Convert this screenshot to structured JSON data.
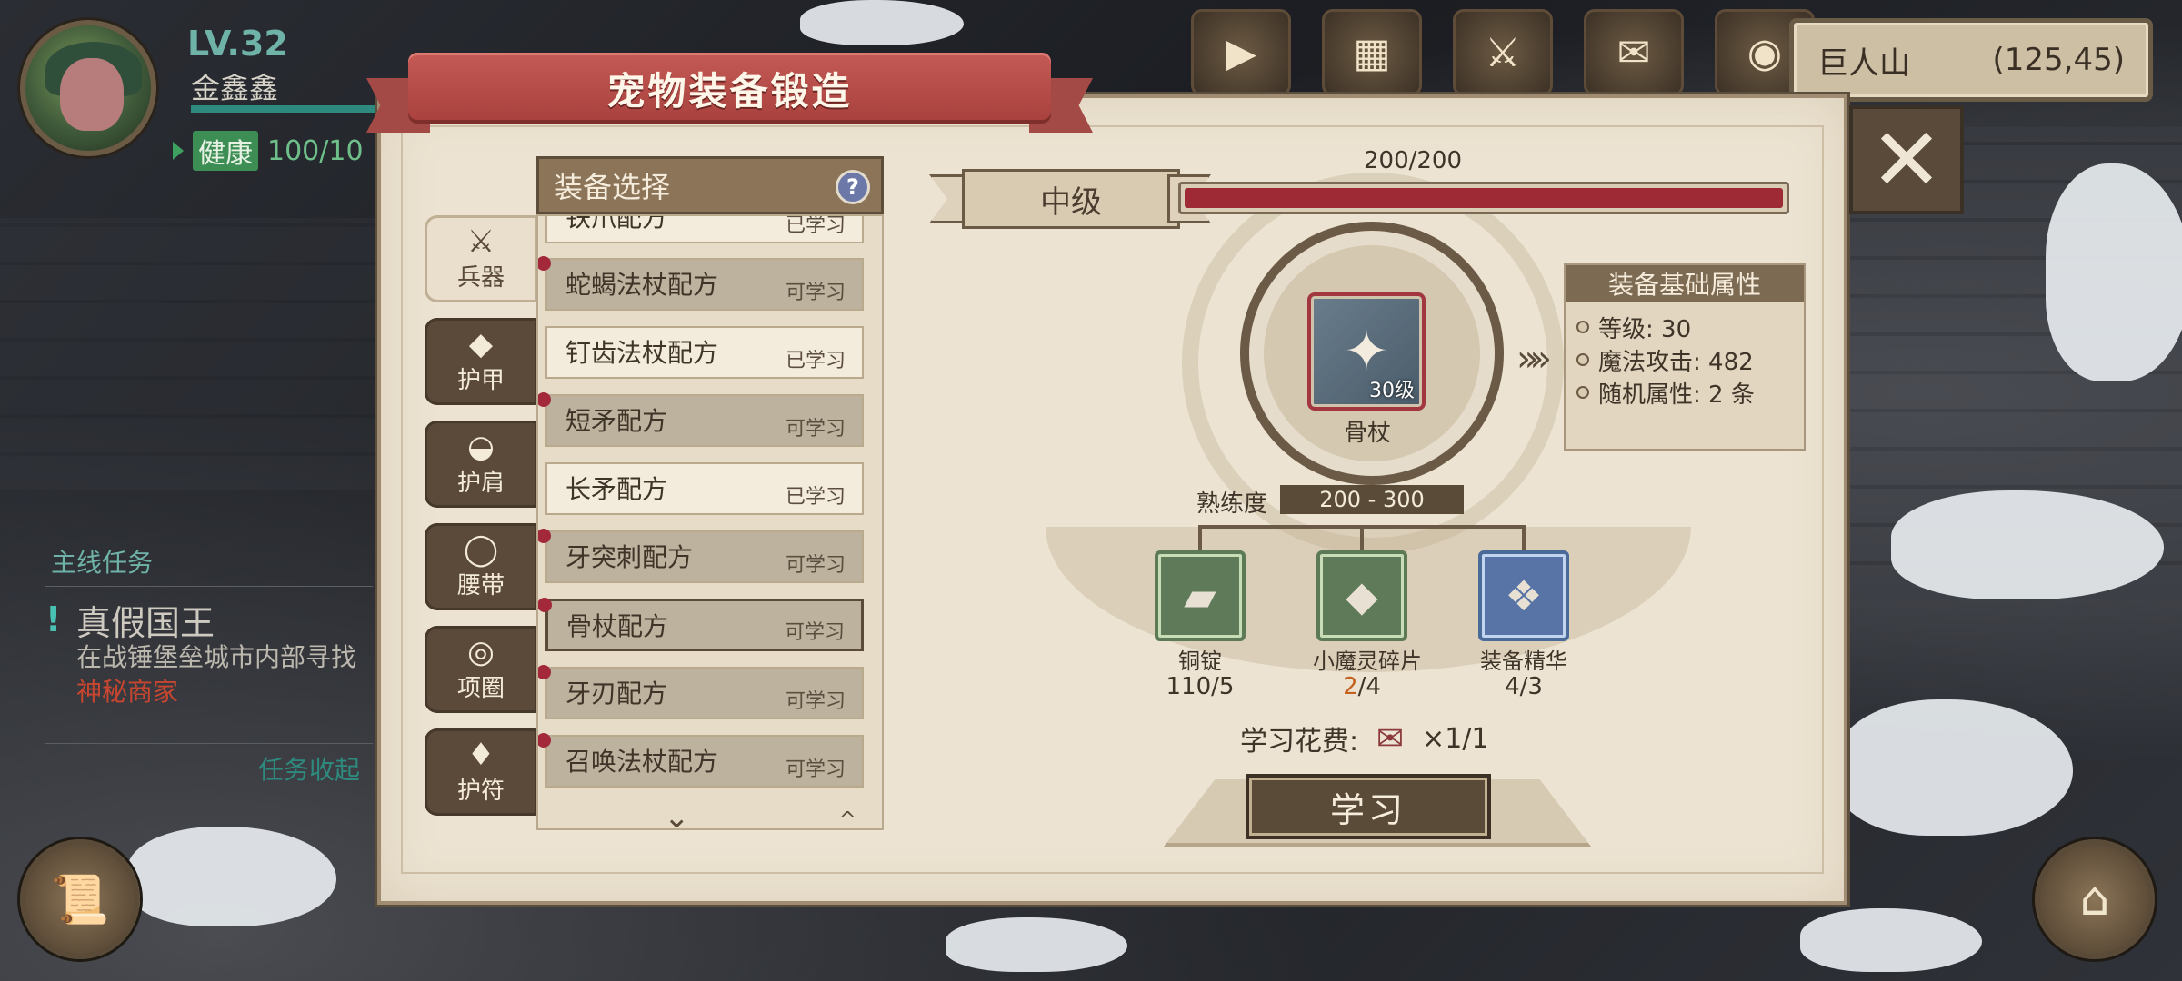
{
  "player": {
    "level": "LV.32",
    "name": "金鑫鑫",
    "status_tag": "健康",
    "health": "100/10"
  },
  "quest": {
    "header": "主线任务",
    "mark": "!",
    "name": "真假国王",
    "desc": "在战锤堡垒城市内部寻找",
    "highlight": "神秘商家",
    "fold": "任务收起"
  },
  "location": {
    "name": "巨人山",
    "coords": "(125,45)"
  },
  "panel": {
    "title": "宠物装备锻造",
    "close_icon": "✕",
    "tabs": [
      {
        "icon": "sword-icon",
        "glyph": "⚔",
        "label": "兵器"
      },
      {
        "icon": "armor-icon",
        "glyph": "◆",
        "label": "护甲"
      },
      {
        "icon": "shoulder-icon",
        "glyph": "◒",
        "label": "护肩"
      },
      {
        "icon": "belt-icon",
        "glyph": "◯",
        "label": "腰带"
      },
      {
        "icon": "collar-icon",
        "glyph": "◎",
        "label": "项圈"
      },
      {
        "icon": "amulet-icon",
        "glyph": "♦",
        "label": "护符"
      }
    ],
    "list": {
      "header": "装备选择",
      "help": "?",
      "items": [
        {
          "name": "铁爪配方",
          "status": "已学习"
        },
        {
          "name": "蛇蝎法杖配方",
          "status": "可学习"
        },
        {
          "name": "钉齿法杖配方",
          "status": "已学习"
        },
        {
          "name": "短矛配方",
          "status": "可学习"
        },
        {
          "name": "长矛配方",
          "status": "已学习"
        },
        {
          "name": "牙突刺配方",
          "status": "可学习"
        },
        {
          "name": "骨杖配方",
          "status": "可学习"
        },
        {
          "name": "牙刃配方",
          "status": "可学习"
        },
        {
          "name": "召唤法杖配方",
          "status": "可学习"
        }
      ],
      "chevron_down": "⌄",
      "chevron_up": "^"
    },
    "forge": {
      "grade": "中级",
      "progress_text": "200/200",
      "progress_value": 1.0,
      "item": {
        "name": "骨杖",
        "level": "30级",
        "glyph": "✦"
      },
      "arrows": "»»",
      "attrs": {
        "title": "装备基础属性",
        "items": [
          "等级: 30",
          "魔法攻击: 482",
          "随机属性: 2 条"
        ]
      },
      "proficiency_label": "熟练度",
      "proficiency_value": "200 - 300",
      "materials": [
        {
          "name": "铜锭",
          "have": "110",
          "need": "/5",
          "lack": false,
          "glyph": "▰"
        },
        {
          "name": "小魔灵碎片",
          "have": "2",
          "need": "/4",
          "lack": true,
          "glyph": "◆"
        },
        {
          "name": "装备精华",
          "have": "4",
          "need": "/3",
          "lack": false,
          "glyph": "❖"
        }
      ],
      "cost_label": "学习花费:",
      "cost_value": "×1/1",
      "learn_button": "学习"
    }
  },
  "colors": {
    "accent_red": "#9d2a35",
    "panel_bg": "#ece3d2",
    "brown": "#5a4a38",
    "teal": "#6fb3a8"
  }
}
